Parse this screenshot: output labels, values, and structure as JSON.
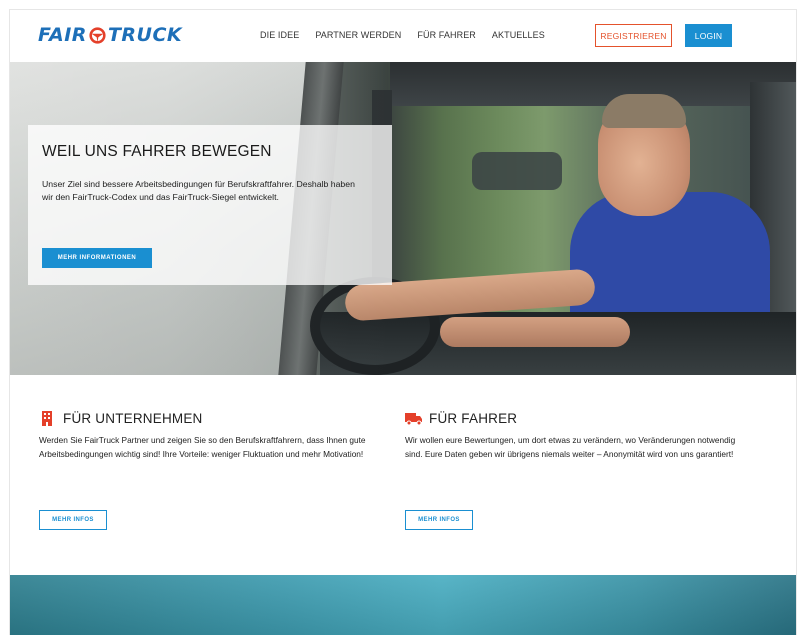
{
  "header": {
    "logo": {
      "part1": "FAIR",
      "part2": "TRUCK",
      "mark_icon": "steering-wheel-icon",
      "color": "#1d6fb8"
    },
    "nav": [
      {
        "label": "DIE IDEE"
      },
      {
        "label": "PARTNER WERDEN"
      },
      {
        "label": "FÜR FAHRER"
      },
      {
        "label": "AKTUELLES"
      }
    ],
    "register_label": "REGISTRIEREN",
    "login_label": "LOGIN"
  },
  "hero": {
    "title": "WEIL UNS FAHRER BEWEGEN",
    "text": "Unser Ziel sind bessere Arbeitsbedingungen für Berufskraftfahrer. Deshalb haben wir den FairTruck-Codex und das FairTruck-Siegel entwickelt.",
    "button_label": "MEHR INFORMATIONEN"
  },
  "features": {
    "companies": {
      "icon": "building-icon",
      "title": "FÜR UNTERNEHMEN",
      "text": "Werden Sie FairTruck Partner und zeigen Sie so den Berufskraftfahrern, dass Ihnen gute Arbeitsbedingungen wichtig sind! Ihre Vorteile: weniger Fluktuation und mehr Motivation!",
      "button_label": "MEHR INFOS"
    },
    "drivers": {
      "icon": "truck-icon",
      "title": "FÜR FAHRER",
      "text": "Wir wollen eure Bewertungen, um dort etwas zu verändern, wo Veränderungen notwendig sind. Eure Daten geben wir übrigens niemals weiter – Anonymität wird von uns garantiert!",
      "button_label": "MEHR INFOS"
    }
  },
  "colors": {
    "primary_blue": "#1a8fd1",
    "register_orange": "#e4522c",
    "icon_red": "#e4402a"
  }
}
